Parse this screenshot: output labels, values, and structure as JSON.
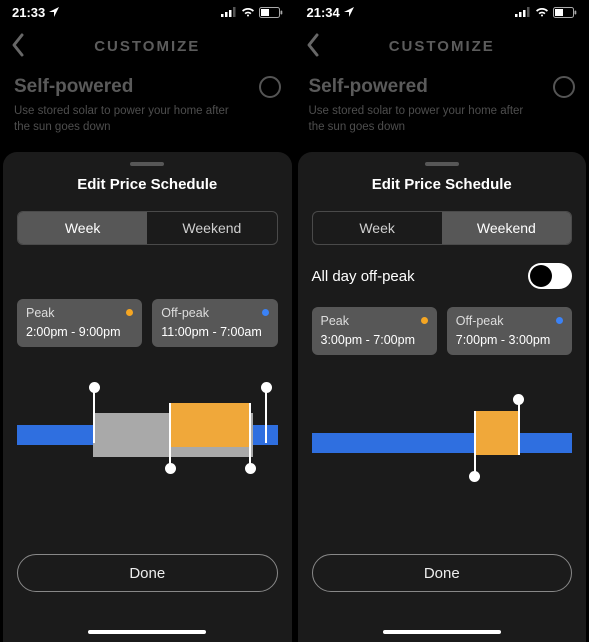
{
  "left": {
    "status": {
      "time": "21:33"
    },
    "header": {
      "title": "CUSTOMIZE"
    },
    "option": {
      "title": "Self-powered",
      "desc": "Use stored solar to power your home after the sun goes down"
    },
    "sheet": {
      "title": "Edit Price Schedule",
      "seg": {
        "week": "Week",
        "weekend": "Weekend",
        "active": "week"
      },
      "chips": {
        "peak_label": "Peak",
        "peak_time": "2:00pm - 9:00pm",
        "off_label": "Off-peak",
        "off_time": "11:00pm - 7:00am"
      },
      "done": "Done"
    }
  },
  "right": {
    "status": {
      "time": "21:34"
    },
    "header": {
      "title": "CUSTOMIZE"
    },
    "option": {
      "title": "Self-powered",
      "desc": "Use stored solar to power your home after the sun goes down"
    },
    "sheet": {
      "title": "Edit Price Schedule",
      "seg": {
        "week": "Week",
        "weekend": "Weekend",
        "active": "weekend"
      },
      "allday_label": "All day off-peak",
      "allday_on": false,
      "chips": {
        "peak_label": "Peak",
        "peak_time": "3:00pm - 7:00pm",
        "off_label": "Off-peak",
        "off_time": "7:00pm - 3:00pm"
      },
      "done": "Done"
    }
  },
  "colors": {
    "accent_orange": "#f0a83a",
    "accent_blue": "#2f6fe0",
    "sheet_bg": "#1b1b1b"
  }
}
